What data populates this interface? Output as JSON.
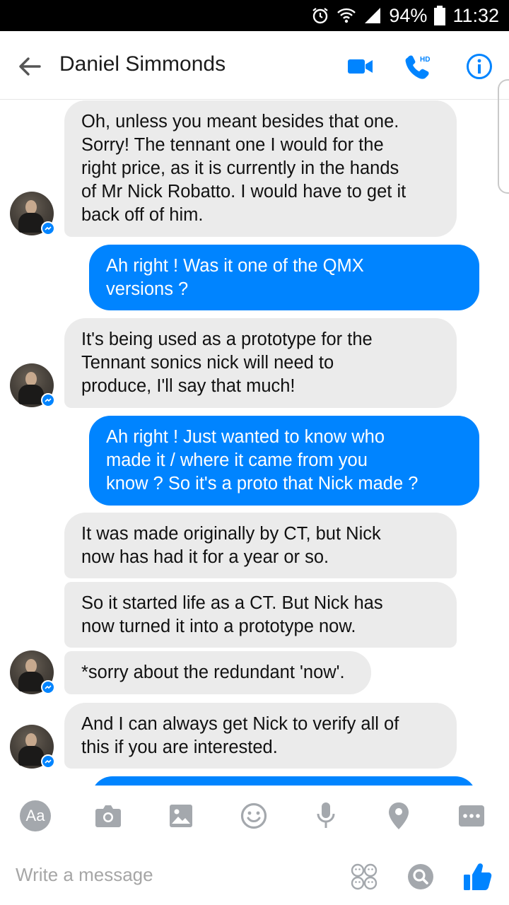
{
  "status_bar": {
    "battery": "94%",
    "time": "11:32",
    "icons": [
      "alarm-icon",
      "wifi-icon",
      "signal-icon",
      "battery-icon"
    ]
  },
  "header": {
    "contact_name": "Daniel Simmonds",
    "icons": [
      "back-arrow-icon",
      "video-call-icon",
      "hd-voice-call-icon",
      "info-icon"
    ]
  },
  "messages": [
    {
      "from": "contact",
      "text": "Oh, unless you meant besides that one.\nSorry! The tennant one I would for the\nright price, as it is currently in the hands\nof Mr Nick Robatto. I would have to get it\nback off of him."
    },
    {
      "from": "me",
      "text": "Ah right ! Was it one of the QMX\nversions ?"
    },
    {
      "from": "contact",
      "text": "It's being used as a prototype for the\nTennant sonics nick will need to\nproduce, I'll say that much!"
    },
    {
      "from": "me",
      "text": "Ah right ! Just wanted to know who\nmade it / where it came from you\nknow ? So it's a proto that Nick made ?"
    },
    {
      "from": "contact",
      "text": "It was made originally by CT, but Nick\nnow has had it for a year or so."
    },
    {
      "from": "contact",
      "text": "So it started life as a CT. But Nick has\nnow turned  it into a prototype now."
    },
    {
      "from": "contact",
      "text": "*sorry about the redundant 'now'."
    },
    {
      "from": "contact",
      "text": "And I can always get Nick to verify all of\nthis if you are interested."
    }
  ],
  "toolbar": {
    "text_button_label": "Aa",
    "icons": [
      "text-format-icon",
      "camera-icon",
      "gallery-icon",
      "emoji-icon",
      "microphone-icon",
      "location-icon",
      "more-icon"
    ]
  },
  "composer": {
    "placeholder": "Write a message",
    "icons": [
      "stickers-icon",
      "gif-search-icon",
      "thumbs-up-icon"
    ]
  },
  "colors": {
    "brand_blue": "#0084ff",
    "incoming_bubble": "#ebebeb",
    "toolbar_icon": "#a4a8ad"
  }
}
